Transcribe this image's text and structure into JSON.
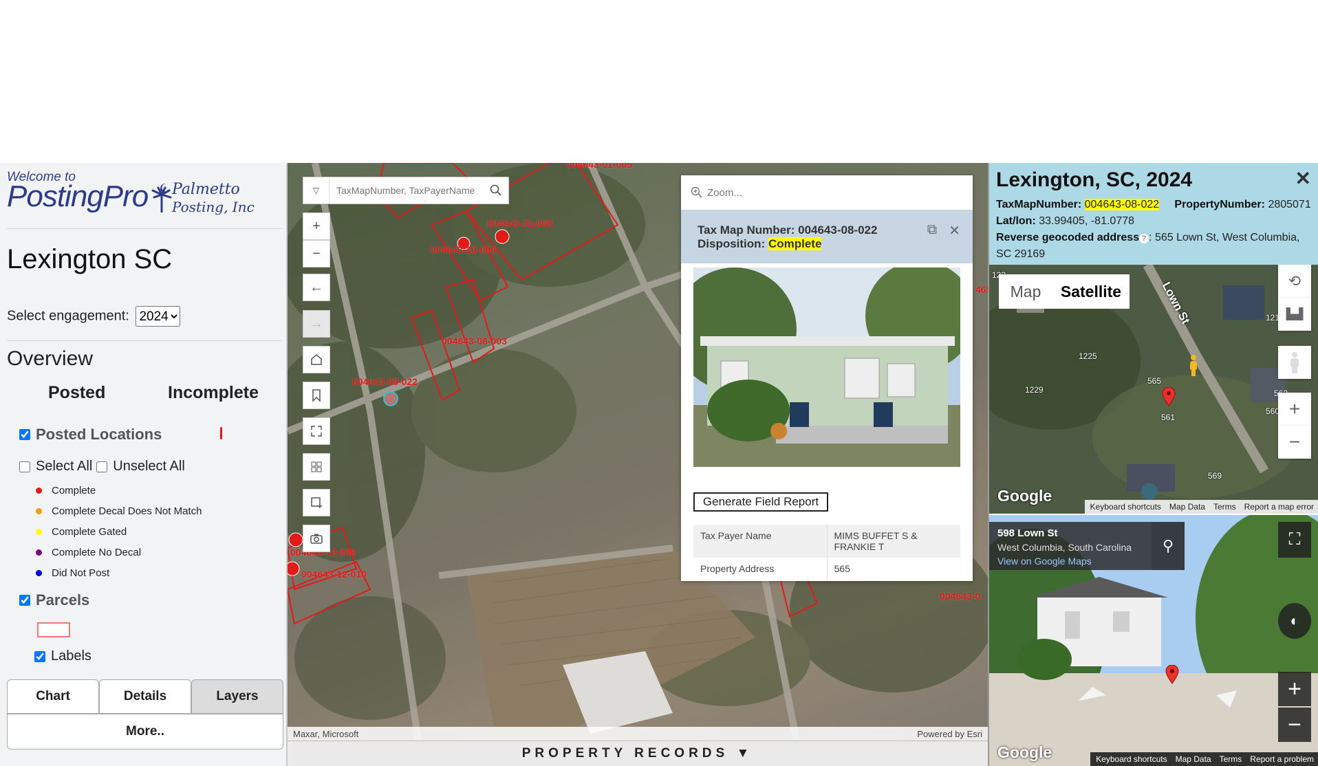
{
  "sidebar": {
    "logo": {
      "welcome": "Welcome to",
      "brand": "PostingPro",
      "partner_line1": "Palmetto",
      "partner_line2": "Posting, Inc"
    },
    "city": "Lexington SC",
    "engagement_label": "Select engagement:",
    "engagement_value": "2024",
    "overview_title": "Overview",
    "overview_tabs": [
      "Posted",
      "Incomplete"
    ],
    "posted_locations_label": "Posted Locations",
    "select_all_label": "Select All",
    "unselect_all_label": "Unselect All",
    "legend": [
      {
        "label": "Complete",
        "color": "#e31a1a"
      },
      {
        "label": "Complete Decal Does Not Match",
        "color": "#ff9900"
      },
      {
        "label": "Complete Gated",
        "color": "#ffff00"
      },
      {
        "label": "Complete No Decal",
        "color": "#800080"
      },
      {
        "label": "Did Not Post",
        "color": "#0000dd"
      }
    ],
    "parcels_label": "Parcels",
    "labels_label": "Labels",
    "tabs": [
      "Chart",
      "Details",
      "Layers"
    ],
    "active_tab": "Layers",
    "more_label": "More.."
  },
  "map": {
    "search_placeholder": "TaxMapNumber, TaxPayerName",
    "attribution_left": "Maxar, Microsoft",
    "attribution_right": "Powered by Esri",
    "parcel_labels": [
      "004643-01-005",
      "004643-01-008",
      "004643-10-006",
      "004643-08-003",
      "004643-08-022",
      "004643-12-009",
      "004643-12-010",
      "004643-0",
      "465"
    ],
    "popup": {
      "zoom_label": "Zoom...",
      "tax_map_label": "Tax Map Number:",
      "tax_map_value": "004643-08-022",
      "disposition_label": "Disposition:",
      "disposition_value": "Complete",
      "generate_button": "Generate Field Report",
      "fields": [
        {
          "key": "Tax Payer Name",
          "value": "MIMS BUFFET S & FRANKIE T"
        },
        {
          "key": "Property Address",
          "value": "565"
        }
      ]
    }
  },
  "records_bar": "PROPERTY RECORDS ▼",
  "right_panel": {
    "title": "Lexington, SC, 2024",
    "tax_map_label": "TaxMapNumber:",
    "tax_map_value": "004643-08-022",
    "property_number_label": "PropertyNumber:",
    "property_number_value": "2805071",
    "latlon_label": "Lat/lon:",
    "latlon_value": "33.99405, -81.0778",
    "reverse_label": "Reverse geocoded address",
    "reverse_value": ": 565 Lown St, West Columbia, SC 29169",
    "gmap": {
      "tab_map": "Map",
      "tab_satellite": "Satellite",
      "street_name": "Lown St",
      "house_numbers": [
        "1225",
        "1229",
        "565",
        "561",
        "569",
        "1213",
        "560",
        "562",
        "122"
      ],
      "logo": "Google",
      "footer": [
        "Keyboard shortcuts",
        "Map Data",
        "Terms",
        "Report a map error"
      ]
    },
    "streetview": {
      "address": "598 Lown St",
      "city": "West Columbia, South Carolina",
      "link": "View on Google Maps",
      "logo": "Google",
      "footer": [
        "Keyboard shortcuts",
        "Map Data",
        "Terms",
        "Report a problem"
      ]
    }
  }
}
